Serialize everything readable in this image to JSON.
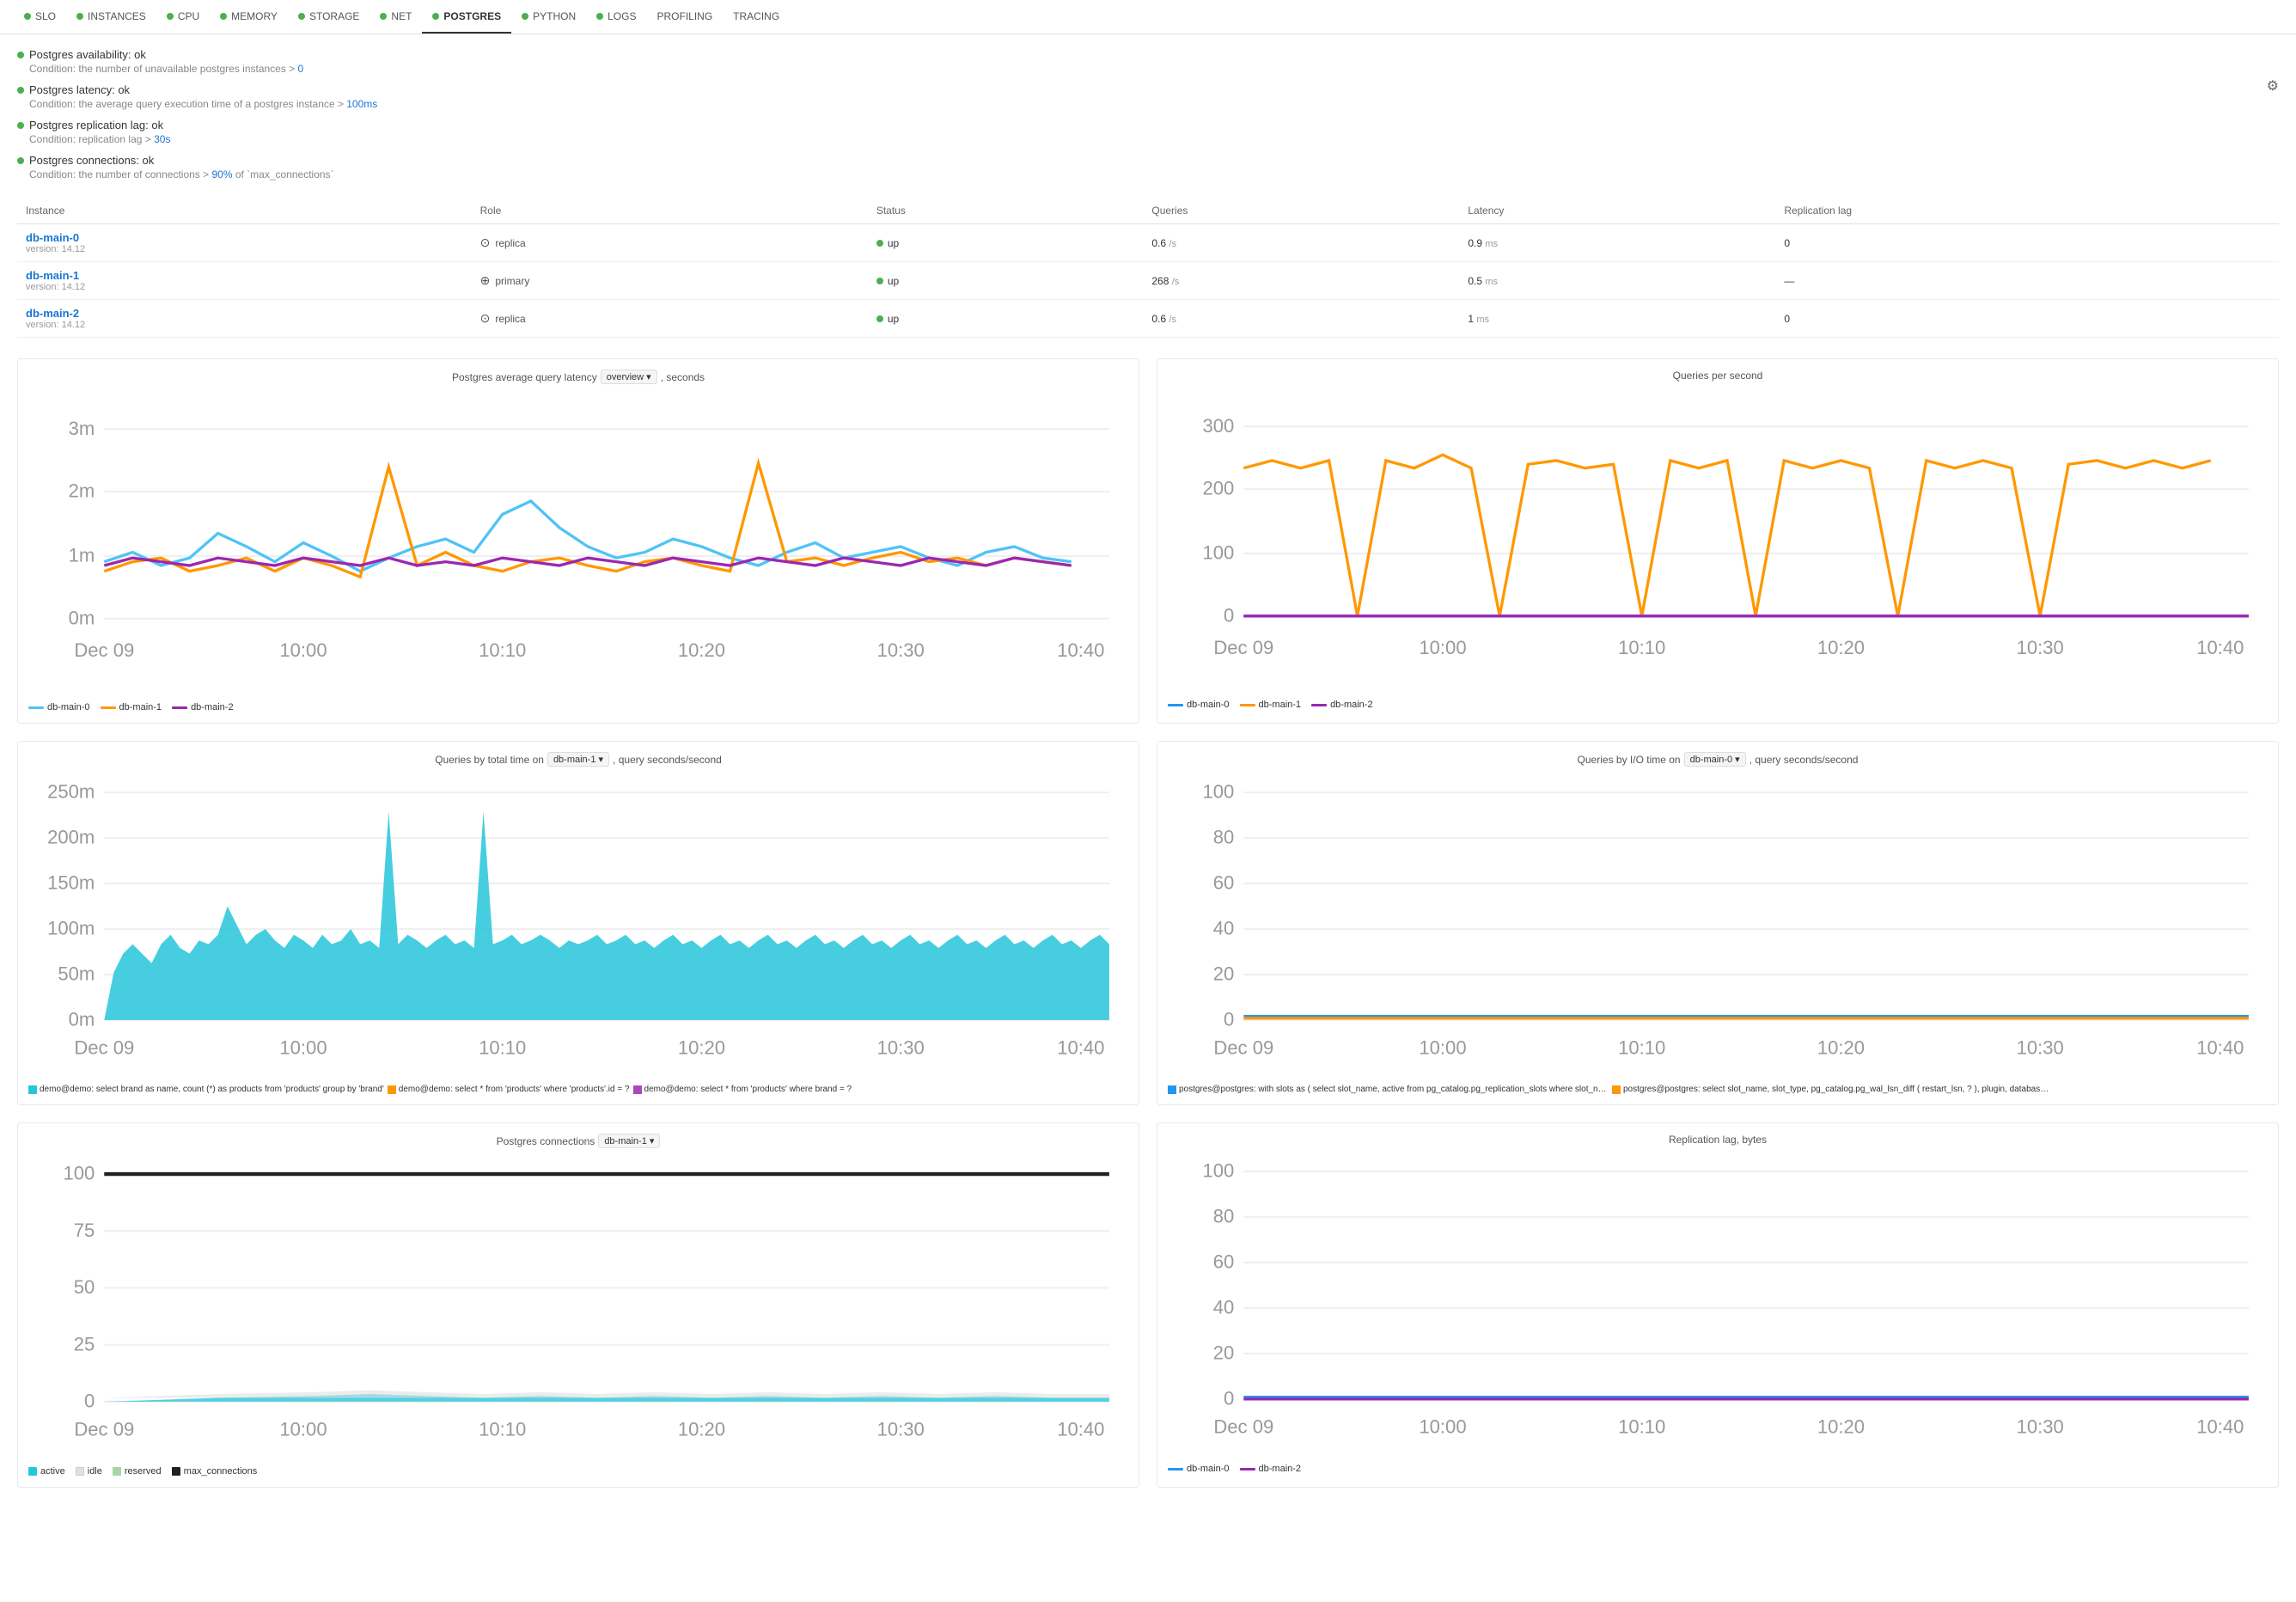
{
  "nav": {
    "items": [
      {
        "label": "SLO",
        "dot": "green",
        "active": false
      },
      {
        "label": "INSTANCES",
        "dot": "green",
        "active": false
      },
      {
        "label": "CPU",
        "dot": "green",
        "active": false
      },
      {
        "label": "MEMORY",
        "dot": "green",
        "active": false
      },
      {
        "label": "STORAGE",
        "dot": "green",
        "active": false
      },
      {
        "label": "NET",
        "dot": "green",
        "active": false
      },
      {
        "label": "POSTGRES",
        "dot": "green",
        "active": true
      },
      {
        "label": "PYTHON",
        "dot": "green",
        "active": false
      },
      {
        "label": "LOGS",
        "dot": "green",
        "active": false
      },
      {
        "label": "PROFILING",
        "dot": null,
        "active": false
      },
      {
        "label": "TRACING",
        "dot": null,
        "active": false
      }
    ]
  },
  "status": {
    "items": [
      {
        "title": "Postgres availability: ok",
        "condition": "Condition: the number of unavailable postgres instances >",
        "link": "0"
      },
      {
        "title": "Postgres latency: ok",
        "condition": "Condition: the average query execution time of a postgres instance >",
        "link": "100ms"
      },
      {
        "title": "Postgres replication lag: ok",
        "condition": "Condition: replication lag >",
        "link": "30s"
      },
      {
        "title": "Postgres connections: ok",
        "condition": "Condition: the number of connections >",
        "link": "90%",
        "linkSuffix": " of `max_connections`"
      }
    ]
  },
  "table": {
    "headers": [
      "Instance",
      "Role",
      "Status",
      "Queries",
      "Latency",
      "Replication lag"
    ],
    "rows": [
      {
        "name": "db-main-0",
        "version": "version: 14.12",
        "role": "replica",
        "role_type": "replica",
        "status": "up",
        "queries": "0.6",
        "queries_unit": "/s",
        "latency": "0.9",
        "latency_unit": "ms",
        "replication_lag": "0"
      },
      {
        "name": "db-main-1",
        "version": "version: 14.12",
        "role": "primary",
        "role_type": "primary",
        "status": "up",
        "queries": "268",
        "queries_unit": "/s",
        "latency": "0.5",
        "latency_unit": "ms",
        "replication_lag": "—"
      },
      {
        "name": "db-main-2",
        "version": "version: 14.12",
        "role": "replica",
        "role_type": "replica",
        "status": "up",
        "queries": "0.6",
        "queries_unit": "/s",
        "latency": "1",
        "latency_unit": "ms",
        "replication_lag": "0"
      }
    ]
  },
  "charts": {
    "latency": {
      "title": "Postgres average query latency",
      "dropdown": "overview",
      "subtitle": ", seconds",
      "yLabels": [
        "3m",
        "2m",
        "1m",
        "0m"
      ],
      "xLabels": [
        "Dec 09",
        "10:00",
        "10:10",
        "10:20",
        "10:30",
        "10:40"
      ],
      "legend": [
        "db-main-0",
        "db-main-1",
        "db-main-2"
      ],
      "legendColors": [
        "#4fc3f7",
        "#ff9800",
        "#9c27b0"
      ]
    },
    "qps": {
      "title": "Queries per second",
      "yLabels": [
        "300",
        "200",
        "100",
        "0"
      ],
      "xLabels": [
        "Dec 09",
        "10:00",
        "10:10",
        "10:20",
        "10:30",
        "10:40"
      ],
      "legend": [
        "db-main-0",
        "db-main-1",
        "db-main-2"
      ],
      "legendColors": [
        "#2196f3",
        "#ff9800",
        "#9c27b0"
      ]
    },
    "queriesTotal": {
      "title": "Queries by total time on",
      "dropdown": "db-main-1",
      "subtitle": ", query seconds/second",
      "yLabels": [
        "250m",
        "200m",
        "150m",
        "100m",
        "50m",
        "0m"
      ],
      "xLabels": [
        "Dec 09",
        "10:00",
        "10:10",
        "10:20",
        "10:30",
        "10:40"
      ],
      "legends": [
        {
          "color": "#26c6da",
          "text": "demo@demo: select brand as name, count (*) as products from 'products' group by 'brand'"
        },
        {
          "color": "#ff9800",
          "text": "demo@demo: select * from 'products' where 'products'.id = ?"
        },
        {
          "color": "#ab47bc",
          "text": "demo@demo: select * from 'products' where brand = ?"
        }
      ]
    },
    "queriesIO": {
      "title": "Queries by I/O time on",
      "dropdown": "db-main-0",
      "subtitle": ", query seconds/second",
      "yLabels": [
        "100",
        "80",
        "60",
        "40",
        "20",
        "0"
      ],
      "xLabels": [
        "Dec 09",
        "10:00",
        "10:10",
        "10:20",
        "10:30",
        "10:40"
      ],
      "legends": [
        {
          "color": "#2196f3",
          "text": "postgres@postgres: with slots as (select slot_name, active from pg_catalog.pg_replication_slots where slot_name = ?), dropped as (select pg_catalo..."
        },
        {
          "color": "#ff9800",
          "text": "postgres@postgres: select slot_name, slot_type, pg_catalog.pg_wal_lsn_diff (restart_lsn, ?), plugin, database, datoid, catalog_xmin, pg_catalog.pg_w..."
        }
      ]
    },
    "connections": {
      "title": "Postgres connections",
      "dropdown": "db-main-1",
      "yLabels": [
        "100",
        "75",
        "50",
        "25",
        "0"
      ],
      "xLabels": [
        "Dec 09",
        "10:00",
        "10:10",
        "10:20",
        "10:30",
        "10:40"
      ],
      "legends": [
        {
          "color": "#26c6da",
          "text": "active"
        },
        {
          "color": "#e0e0e0",
          "text": "idle"
        },
        {
          "color": "#a5d6a7",
          "text": "reserved"
        },
        {
          "color": "#212121",
          "text": "max_connections"
        }
      ]
    },
    "replicationLag": {
      "title": "Replication lag, bytes",
      "yLabels": [
        "100",
        "80",
        "60",
        "40",
        "20",
        "0"
      ],
      "xLabels": [
        "Dec 09",
        "10:00",
        "10:10",
        "10:20",
        "10:30",
        "10:40"
      ],
      "legends": [
        {
          "color": "#2196f3",
          "text": "db-main-0"
        },
        {
          "color": "#9c27b0",
          "text": "db-main-2"
        }
      ]
    }
  }
}
